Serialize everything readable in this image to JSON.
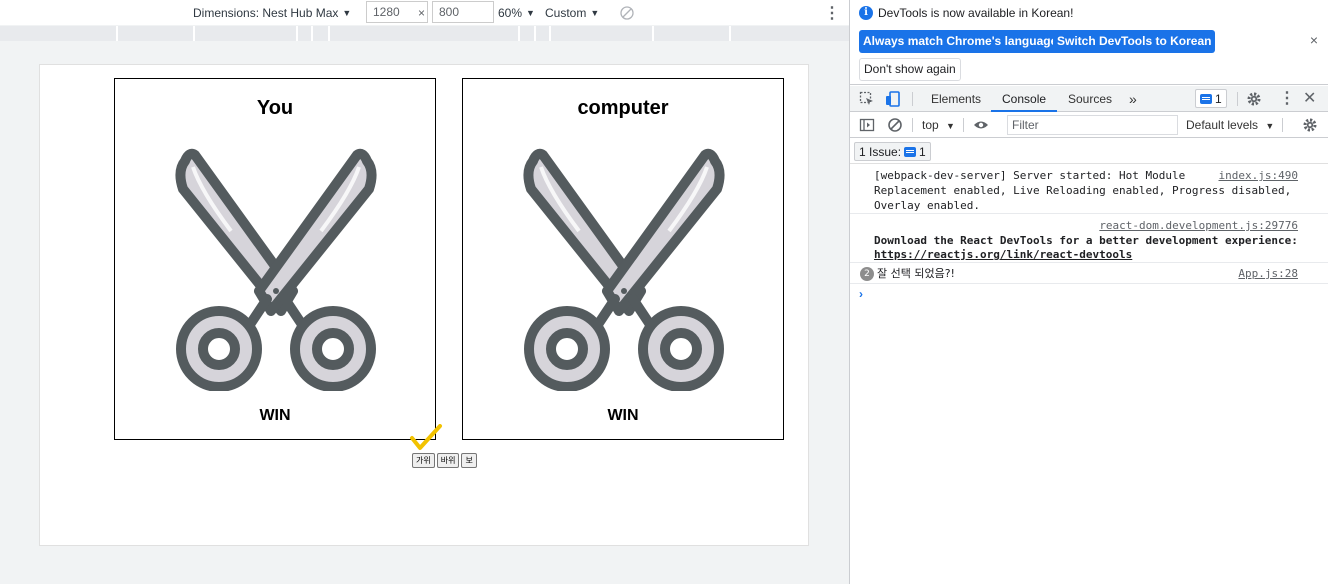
{
  "device_toolbar": {
    "dimensions_label": "Dimensions: Nest Hub Max",
    "width": "1280",
    "times": "×",
    "height": "800",
    "zoom": "60%",
    "throttle": "Custom"
  },
  "app": {
    "cards": [
      {
        "title": "You",
        "result": "WIN",
        "choice_icon": "scissors-icon"
      },
      {
        "title": "computer",
        "result": "WIN",
        "choice_icon": "scissors-icon"
      }
    ],
    "buttons": [
      "가위",
      "바위",
      "보"
    ]
  },
  "devtools": {
    "info_message": "DevTools is now available in Korean!",
    "btn_match": "Always match Chrome's language",
    "btn_switch": "Switch DevTools to Korean",
    "btn_dont_show": "Don't show again",
    "close": "×",
    "tabs": [
      "Elements",
      "Console",
      "Sources"
    ],
    "more_tabs": "»",
    "issue_badge_count": "1",
    "console_toolbar": {
      "context": "top",
      "filter_placeholder": "Filter",
      "levels": "Default levels"
    },
    "issues_label": "1 Issue:",
    "issues_count": "1",
    "logs": [
      {
        "text": "[webpack-dev-server] Server started: Hot Module\nReplacement enabled, Live Reloading enabled, Progress disabled,\nOverlay enabled.",
        "source": "index.js:490"
      },
      {
        "text": "Download the React DevTools for a better development experience:",
        "link": "https://reactjs.org/link/react-devtools",
        "source": "react-dom.development.js:29776"
      },
      {
        "text": "잘 선택 되었음?!",
        "count": "2",
        "source": "App.js:28"
      }
    ],
    "prompt": "›"
  },
  "colors": {
    "accent": "#1a73e8",
    "check": "#f2c200",
    "scissors_outline": "#545b5e"
  }
}
